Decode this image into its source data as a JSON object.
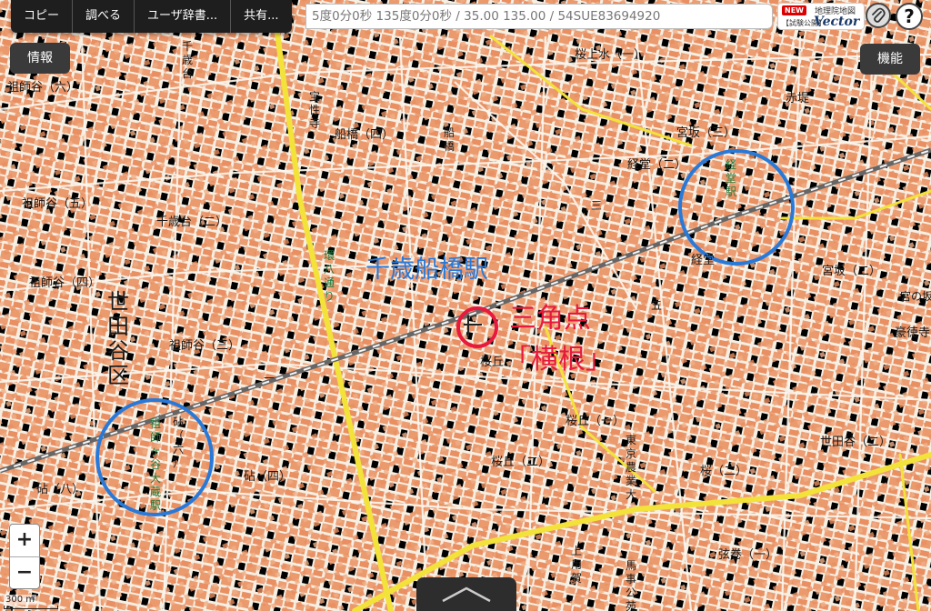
{
  "toolbar": {
    "menu_items": [
      "コピー",
      "調べる",
      "ユーザ辞書...",
      "共有..."
    ],
    "coord_text": "5度0分0秒 135度0分0秒 / 35.00 135.00 / 54SUE83694920",
    "brand_new": "NEW",
    "brand_name": "地理院地図",
    "brand_sub": "【試験公開】",
    "brand_vector": "Vector",
    "help_label": "?"
  },
  "buttons": {
    "info": "情報",
    "function": "機能",
    "zoom_in": "+",
    "zoom_out": "−"
  },
  "scale": "300 m",
  "annotations": {
    "station": "千歳船橋駅",
    "triangle_line1": "三角点",
    "triangle_line2": "「横根」",
    "colors": {
      "blue": "#2979d8",
      "red": "#e8193c"
    }
  },
  "map": {
    "road_color": "#f3e23a",
    "block_color": "#ec9d73",
    "labels": [
      {
        "text": "祖師谷（六）"
      },
      {
        "text": "千歳台"
      },
      {
        "text": "宝性寺"
      },
      {
        "text": "船橋（四）"
      },
      {
        "text": "船橋"
      },
      {
        "text": "桜上水（一）"
      },
      {
        "text": "赤堤"
      },
      {
        "text": "経堂（二）"
      },
      {
        "text": "経堂駅"
      },
      {
        "text": "宮坂（三）"
      },
      {
        "text": "宮坂（二）"
      },
      {
        "text": "経堂"
      },
      {
        "text": "祖師谷（五）"
      },
      {
        "text": "千歳台（二）"
      },
      {
        "text": "祖師谷（四）"
      },
      {
        "text": "環八通り"
      },
      {
        "text": "世田谷区"
      },
      {
        "text": "祖師谷（三）"
      },
      {
        "text": "桜丘"
      },
      {
        "text": "桜丘（一）"
      },
      {
        "text": "東京農業大"
      },
      {
        "text": "世田谷（二）"
      },
      {
        "text": "砧（六）"
      },
      {
        "text": "祖師ヶ谷大蔵駅"
      },
      {
        "text": "砧（四）"
      },
      {
        "text": "砧（八）"
      },
      {
        "text": "桜丘（二）"
      },
      {
        "text": "桜（二）"
      },
      {
        "text": "弦巻（一）"
      },
      {
        "text": "上用賀"
      },
      {
        "text": "馬事公苑"
      },
      {
        "text": "豪徳寺"
      },
      {
        "text": "宮の坂"
      },
      {
        "text": "三"
      },
      {
        "text": "五"
      },
      {
        "text": "一"
      }
    ]
  }
}
